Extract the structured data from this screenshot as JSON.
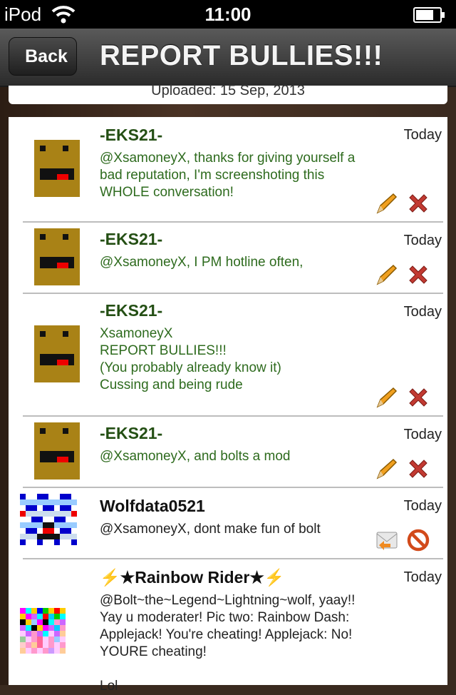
{
  "status_bar": {
    "carrier": "iPod",
    "time": "11:00",
    "battery_level": 0.75
  },
  "nav": {
    "back_label": "Back",
    "title": "REPORT BULLIES!!!"
  },
  "upload": {
    "text": "Uploaded: 15 Sep, 2013"
  },
  "comments": [
    {
      "name": "-EKS21-",
      "date": "Today",
      "message": "@XsamoneyX, thanks for giving yourself a\nbad reputation, I'm screenshoting this\nWHOLE conversation!",
      "avatar": "face",
      "actions": [
        "pencil-icon",
        "delete-icon"
      ]
    },
    {
      "name": "-EKS21-",
      "date": "Today",
      "message": "@XsamoneyX, I PM hotline often,",
      "avatar": "face",
      "actions": [
        "pencil-icon",
        "delete-icon"
      ]
    },
    {
      "name": "-EKS21-",
      "date": "Today",
      "message": "XsamoneyX\nREPORT BULLIES!!!\n(You probably already know it)\nCussing and being rude",
      "avatar": "face",
      "actions": [
        "pencil-icon",
        "delete-icon"
      ]
    },
    {
      "name": "-EKS21-",
      "date": "Today",
      "message": "@XsamoneyX, and bolts a mod",
      "avatar": "face",
      "actions": [
        "pencil-icon",
        "delete-icon"
      ]
    },
    {
      "name": "Wolfdata0521",
      "date": "Today",
      "message": "@XsamoneyX, dont make fun of bolt",
      "avatar": "blue-pixel",
      "actions": [
        "reply-mail-icon",
        "block-icon"
      ]
    },
    {
      "name": "⚡★Rainbow Rider★⚡",
      "date": "Today",
      "message": "@Bolt~the~Legend~Lightning~wolf, yaay!!\nYay u moderater! Pic two: Rainbow Dash:\nApplejack! You're cheating! Applejack: No!\nYOURE cheating!\n\nLol",
      "avatar": "rainbow-pixel",
      "actions": []
    }
  ]
}
